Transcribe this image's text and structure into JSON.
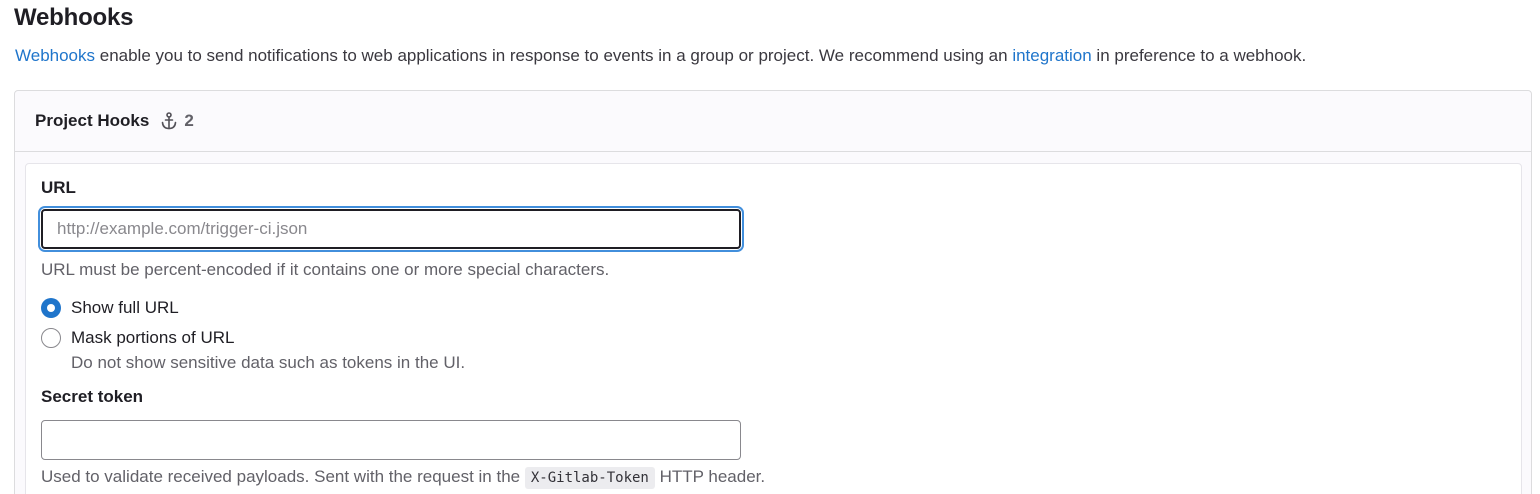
{
  "page": {
    "title": "Webhooks"
  },
  "intro": {
    "link_webhooks": "Webhooks",
    "text_middle": " enable you to send notifications to web applications in response to events in a group or project. We recommend using an ",
    "link_integration": "integration",
    "text_end": " in preference to a webhook."
  },
  "card": {
    "title": "Project Hooks",
    "icon": "anchor-icon",
    "count": "2"
  },
  "form": {
    "url_label": "URL",
    "url_value": "",
    "url_placeholder": "http://example.com/trigger-ci.json",
    "url_help": "URL must be percent-encoded if it contains one or more special characters.",
    "radio_show_full": "Show full URL",
    "radio_mask": "Mask portions of URL",
    "mask_help": "Do not show sensitive data such as tokens in the UI.",
    "secret_label": "Secret token",
    "secret_value": "",
    "secret_help_before": "Used to validate received payloads. Sent with the request in the ",
    "secret_help_code": "X-Gitlab-Token",
    "secret_help_after": " HTTP header."
  },
  "colors": {
    "link": "#1f75cb",
    "focus_ring": "#428fdc",
    "radio_checked": "#1f75cb"
  }
}
